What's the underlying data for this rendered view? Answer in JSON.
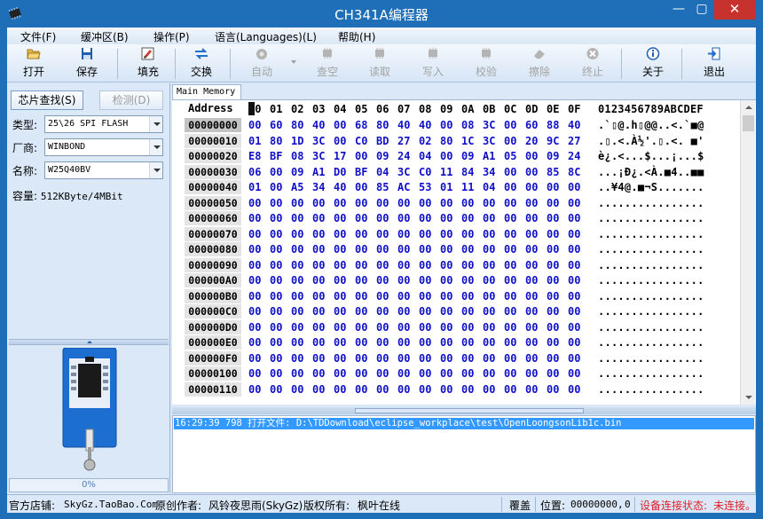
{
  "window": {
    "title": "CH341A编程器",
    "minimize": "—",
    "maximize": "▢",
    "close": "✕"
  },
  "menu": [
    "文件(F)",
    "缓冲区(B)",
    "操作(P)",
    "语言(Languages)(L)",
    "帮助(H)"
  ],
  "toolbar": [
    {
      "label": "打开",
      "icon": "folder-open-icon",
      "enabled": true
    },
    {
      "label": "保存",
      "icon": "floppy-disk-icon",
      "enabled": true
    },
    {
      "label": "填充",
      "icon": "fill-icon",
      "enabled": true
    },
    {
      "label": "交换",
      "icon": "swap-arrows-icon",
      "enabled": true
    },
    {
      "label": "自动",
      "icon": "auto-gear-icon",
      "enabled": false
    },
    {
      "label": "查空",
      "icon": "blank-check-icon",
      "enabled": false
    },
    {
      "label": "读取",
      "icon": "read-icon",
      "enabled": false
    },
    {
      "label": "写入",
      "icon": "write-icon",
      "enabled": false
    },
    {
      "label": "校验",
      "icon": "verify-icon",
      "enabled": false
    },
    {
      "label": "擦除",
      "icon": "erase-icon",
      "enabled": false
    },
    {
      "label": "终止",
      "icon": "stop-icon",
      "enabled": false
    },
    {
      "label": "关于",
      "icon": "info-icon",
      "enabled": true
    },
    {
      "label": "退出",
      "icon": "exit-door-icon",
      "enabled": true
    }
  ],
  "left": {
    "find_chip": "芯片查找(S)",
    "detect": "检测(D)",
    "type_label": "类型:",
    "type_value": "25\\26 SPI FLASH",
    "vendor_label": "厂商:",
    "vendor_value": "WINBOND",
    "name_label": "名称:",
    "name_value": "W25Q40BV",
    "capacity_label": "容量:",
    "capacity_value": "512KByte/4MBit",
    "progress": "0%"
  },
  "memory": {
    "tab": "Main Memory",
    "address_header": "Address",
    "columns": [
      "00",
      "01",
      "02",
      "03",
      "04",
      "05",
      "06",
      "07",
      "08",
      "09",
      "0A",
      "0B",
      "0C",
      "0D",
      "0E",
      "0F"
    ],
    "ascii_header": "0123456789ABCDEF",
    "rows": [
      {
        "addr": "00000000",
        "bytes": [
          "00",
          "60",
          "80",
          "40",
          "00",
          "68",
          "80",
          "40",
          "40",
          "00",
          "08",
          "3C",
          "00",
          "60",
          "88",
          "40"
        ],
        "ascii": ".`▯@.h▯@@..<.`■@"
      },
      {
        "addr": "00000010",
        "bytes": [
          "01",
          "80",
          "1D",
          "3C",
          "00",
          "C0",
          "BD",
          "27",
          "02",
          "80",
          "1C",
          "3C",
          "00",
          "20",
          "9C",
          "27"
        ],
        "ascii": ".▯.<.À½'.▯.<. ■'"
      },
      {
        "addr": "00000020",
        "bytes": [
          "E8",
          "BF",
          "08",
          "3C",
          "17",
          "00",
          "09",
          "24",
          "04",
          "00",
          "09",
          "A1",
          "05",
          "00",
          "09",
          "24"
        ],
        "ascii": "è¿.<...$...¡...$"
      },
      {
        "addr": "00000030",
        "bytes": [
          "06",
          "00",
          "09",
          "A1",
          "D0",
          "BF",
          "04",
          "3C",
          "C0",
          "11",
          "84",
          "34",
          "00",
          "00",
          "85",
          "8C"
        ],
        "ascii": "...¡Ð¿.<À.■4..■■"
      },
      {
        "addr": "00000040",
        "bytes": [
          "01",
          "00",
          "A5",
          "34",
          "40",
          "00",
          "85",
          "AC",
          "53",
          "01",
          "11",
          "04",
          "00",
          "00",
          "00",
          "00"
        ],
        "ascii": "..¥4@.■¬S......."
      },
      {
        "addr": "00000050",
        "bytes": [
          "00",
          "00",
          "00",
          "00",
          "00",
          "00",
          "00",
          "00",
          "00",
          "00",
          "00",
          "00",
          "00",
          "00",
          "00",
          "00"
        ],
        "ascii": "................"
      },
      {
        "addr": "00000060",
        "bytes": [
          "00",
          "00",
          "00",
          "00",
          "00",
          "00",
          "00",
          "00",
          "00",
          "00",
          "00",
          "00",
          "00",
          "00",
          "00",
          "00"
        ],
        "ascii": "................"
      },
      {
        "addr": "00000070",
        "bytes": [
          "00",
          "00",
          "00",
          "00",
          "00",
          "00",
          "00",
          "00",
          "00",
          "00",
          "00",
          "00",
          "00",
          "00",
          "00",
          "00"
        ],
        "ascii": "................"
      },
      {
        "addr": "00000080",
        "bytes": [
          "00",
          "00",
          "00",
          "00",
          "00",
          "00",
          "00",
          "00",
          "00",
          "00",
          "00",
          "00",
          "00",
          "00",
          "00",
          "00"
        ],
        "ascii": "................"
      },
      {
        "addr": "00000090",
        "bytes": [
          "00",
          "00",
          "00",
          "00",
          "00",
          "00",
          "00",
          "00",
          "00",
          "00",
          "00",
          "00",
          "00",
          "00",
          "00",
          "00"
        ],
        "ascii": "................"
      },
      {
        "addr": "000000A0",
        "bytes": [
          "00",
          "00",
          "00",
          "00",
          "00",
          "00",
          "00",
          "00",
          "00",
          "00",
          "00",
          "00",
          "00",
          "00",
          "00",
          "00"
        ],
        "ascii": "................"
      },
      {
        "addr": "000000B0",
        "bytes": [
          "00",
          "00",
          "00",
          "00",
          "00",
          "00",
          "00",
          "00",
          "00",
          "00",
          "00",
          "00",
          "00",
          "00",
          "00",
          "00"
        ],
        "ascii": "................"
      },
      {
        "addr": "000000C0",
        "bytes": [
          "00",
          "00",
          "00",
          "00",
          "00",
          "00",
          "00",
          "00",
          "00",
          "00",
          "00",
          "00",
          "00",
          "00",
          "00",
          "00"
        ],
        "ascii": "................"
      },
      {
        "addr": "000000D0",
        "bytes": [
          "00",
          "00",
          "00",
          "00",
          "00",
          "00",
          "00",
          "00",
          "00",
          "00",
          "00",
          "00",
          "00",
          "00",
          "00",
          "00"
        ],
        "ascii": "................"
      },
      {
        "addr": "000000E0",
        "bytes": [
          "00",
          "00",
          "00",
          "00",
          "00",
          "00",
          "00",
          "00",
          "00",
          "00",
          "00",
          "00",
          "00",
          "00",
          "00",
          "00"
        ],
        "ascii": "................"
      },
      {
        "addr": "000000F0",
        "bytes": [
          "00",
          "00",
          "00",
          "00",
          "00",
          "00",
          "00",
          "00",
          "00",
          "00",
          "00",
          "00",
          "00",
          "00",
          "00",
          "00"
        ],
        "ascii": "................"
      },
      {
        "addr": "00000100",
        "bytes": [
          "00",
          "00",
          "00",
          "00",
          "00",
          "00",
          "00",
          "00",
          "00",
          "00",
          "00",
          "00",
          "00",
          "00",
          "00",
          "00"
        ],
        "ascii": "................"
      },
      {
        "addr": "00000110",
        "bytes": [
          "00",
          "00",
          "00",
          "00",
          "00",
          "00",
          "00",
          "00",
          "00",
          "00",
          "00",
          "00",
          "00",
          "00",
          "00",
          "00"
        ],
        "ascii": "................"
      }
    ]
  },
  "log": [
    "16:29:39 798 打开文件: D:\\TDDownload\\eclipse_workplace\\test\\OpenLoongsonLib1c.bin"
  ],
  "status": {
    "shop_label": "官方店铺:",
    "shop_url": "SkyGz.TaoBao.Com",
    "author_label": "原创作者:",
    "author": "风铃夜思雨(SkyGz)",
    "copyright_label": "版权所有:",
    "copyright": "枫叶在线",
    "mode": "覆盖",
    "position_label": "位置:",
    "position": "00000000,",
    "position_value": "0",
    "device_label": "设备连接状态:",
    "device_state": "未连接。"
  },
  "colors": {
    "accent": "#1e6fb8",
    "hex_blue": "#1010c8",
    "alert": "#e0202a",
    "log_highlight": "#3399ff"
  }
}
